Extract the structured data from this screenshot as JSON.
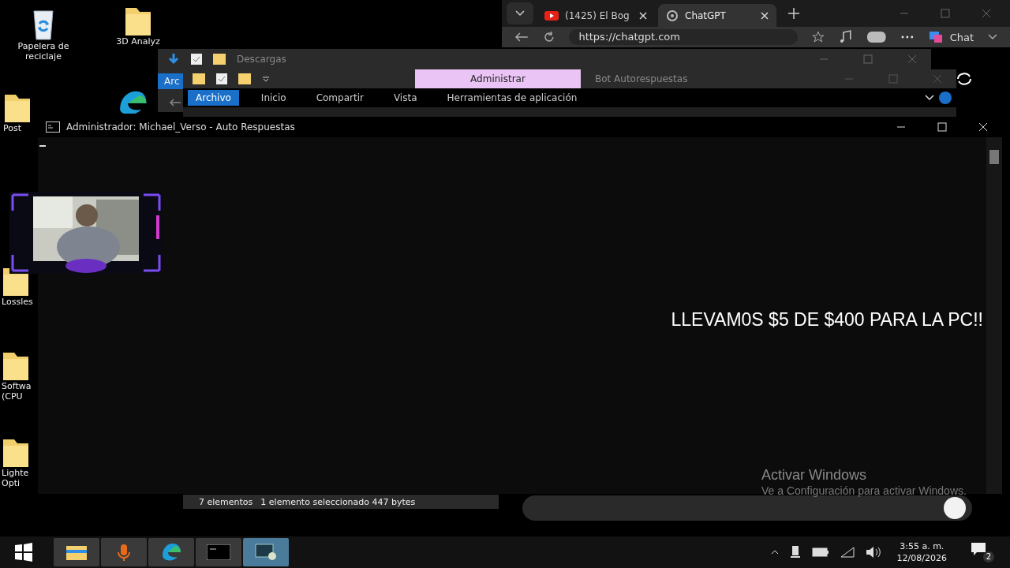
{
  "desktop_icons": [
    {
      "kind": "recycle",
      "lines": [
        "Papelera de",
        "reciclaje"
      ]
    },
    {
      "kind": "folder",
      "lines": [
        "3D Analyz"
      ]
    },
    {
      "kind": "folder",
      "lines": [
        "Post"
      ]
    },
    {
      "kind": "edge"
    },
    {
      "kind": "folder",
      "lines": [
        "Lossles"
      ]
    },
    {
      "kind": "folder",
      "lines": [
        "Softwa",
        "(CPU"
      ]
    },
    {
      "kind": "folder",
      "lines": [
        "Lighte",
        "Opti"
      ]
    }
  ],
  "browser": {
    "tabs": [
      {
        "title": "(1425) El Bog",
        "kind": "video",
        "selected": false
      },
      {
        "title": "ChatGPT",
        "kind": "chat",
        "selected": true
      }
    ],
    "url": "https://chatgpt.com",
    "chat_button": "Chat"
  },
  "explorer_back": {
    "title": "Descargas",
    "file_tab": "Arc"
  },
  "explorer_front": {
    "context_tab": "Administrar",
    "title": "Bot Autorespuestas",
    "ribbon_tabs": [
      {
        "label": "Archivo",
        "selected": true
      },
      {
        "label": "Inicio",
        "selected": false
      },
      {
        "label": "Compartir",
        "selected": false
      },
      {
        "label": "Vista",
        "selected": false
      },
      {
        "label": "Herramientas de aplicación",
        "selected": false
      }
    ],
    "status": [
      "7 elementos",
      "1 elemento seleccionado  447 bytes"
    ]
  },
  "console": {
    "title": "Administrador:  Michael_Verso - Auto Respuestas",
    "output": "LLEVAM0S $5 DE $400 PARA LA PC!!"
  },
  "activation": {
    "title": "Activar Windows",
    "text": "Ve a Configuración para activar Windows."
  },
  "taskbar": {
    "apps": [
      {
        "kind": "explorer",
        "selected": false
      },
      {
        "kind": "mic",
        "selected": false
      },
      {
        "kind": "edge",
        "selected": false
      },
      {
        "kind": "terminal",
        "selected": false
      },
      {
        "kind": "window",
        "selected": true
      }
    ],
    "time": "3:55 a. m.",
    "date": "12/08/2026",
    "notifications": "2"
  }
}
